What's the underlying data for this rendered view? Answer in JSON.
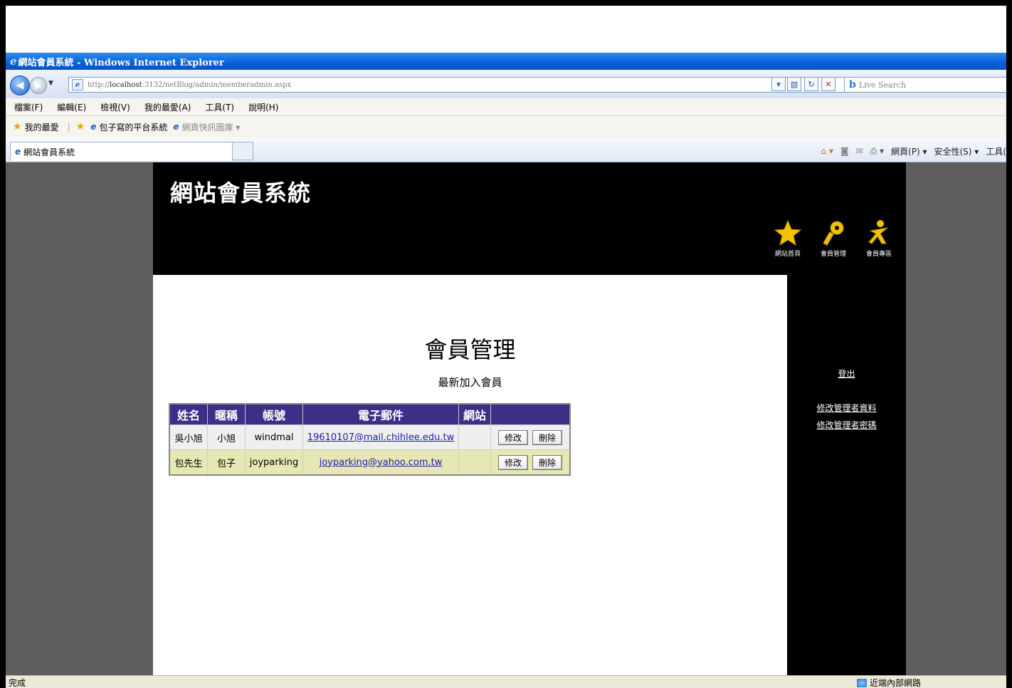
{
  "window": {
    "title": "網站會員系統 - Windows Internet Explorer"
  },
  "addressbar": {
    "url_prefix": "http://",
    "url_host": "localhost",
    "url_rest": ":3132/netBlog/admin/memberadmin.aspx",
    "search_placeholder": "Live Search"
  },
  "menubar": {
    "items": [
      "檔案(F)",
      "編輯(E)",
      "檢視(V)",
      "我的最愛(A)",
      "工具(T)",
      "說明(H)"
    ]
  },
  "favorites": {
    "label": "我的最愛",
    "links": [
      "包子寫的平台系統",
      "網頁快訊圖庫 ▾"
    ]
  },
  "tab": {
    "title": "網站會員系統"
  },
  "commandbar": {
    "items": [
      "網頁(P) ▾",
      "安全性(S) ▾",
      "工具("
    ]
  },
  "site": {
    "title": "網站會員系統",
    "nav": [
      {
        "label": "網站首頁",
        "icon": "star-icon"
      },
      {
        "label": "會員管理",
        "icon": "key-icon"
      },
      {
        "label": "會員專區",
        "icon": "person-icon"
      }
    ],
    "sidebar": {
      "logout": "登出",
      "edit_admin_info": "修改管理者資料",
      "edit_admin_password": "修改管理者密碼"
    }
  },
  "main": {
    "page_title": "會員管理",
    "section_title": "最新加入會員",
    "table": {
      "headers": [
        "姓名",
        "暱稱",
        "帳號",
        "電子郵件",
        "網站",
        ""
      ],
      "rows": [
        {
          "name": "吳小旭",
          "nickname": "小旭",
          "account": "windmal",
          "email": "19610107@mail.chihlee.edu.tw",
          "website": "",
          "edit": "修改",
          "delete": "刪除"
        },
        {
          "name": "包先生",
          "nickname": "包子",
          "account": "joyparking",
          "email": "joyparking@yahoo.com.tw",
          "website": "",
          "edit": "修改",
          "delete": "刪除"
        }
      ]
    }
  },
  "statusbar": {
    "status": "完成",
    "zone": "近端內部網路"
  }
}
